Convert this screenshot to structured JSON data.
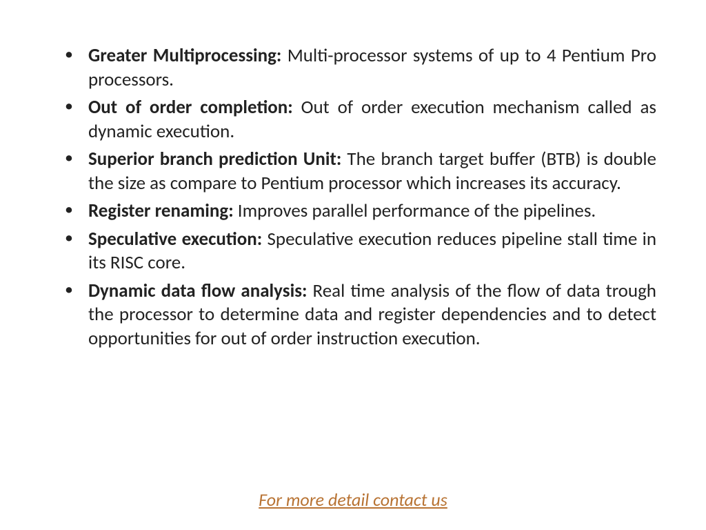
{
  "bullets": [
    {
      "heading": "Greater Multiprocessing:",
      "body": " Multi-processor systems of up to 4 Pentium Pro  processors."
    },
    {
      "heading": "Out of order completion:",
      "body": " Out of order execution mechanism called as dynamic execution."
    },
    {
      "heading": "Superior branch prediction Unit:",
      "body": " The branch target buffer (BTB) is double the size as compare to Pentium processor which increases its accuracy."
    },
    {
      "heading": "Register renaming:",
      "body": " Improves parallel performance of the pipelines."
    },
    {
      "heading": "Speculative execution:",
      "body": " Speculative execution reduces pipeline stall time in its RISC core."
    },
    {
      "heading": "Dynamic data flow analysis:",
      "body": " Real time analysis of the flow of data trough the processor to determine data and register dependencies and to detect opportunities for out of order instruction execution."
    }
  ],
  "footer": {
    "label": "For more detail contact us"
  }
}
